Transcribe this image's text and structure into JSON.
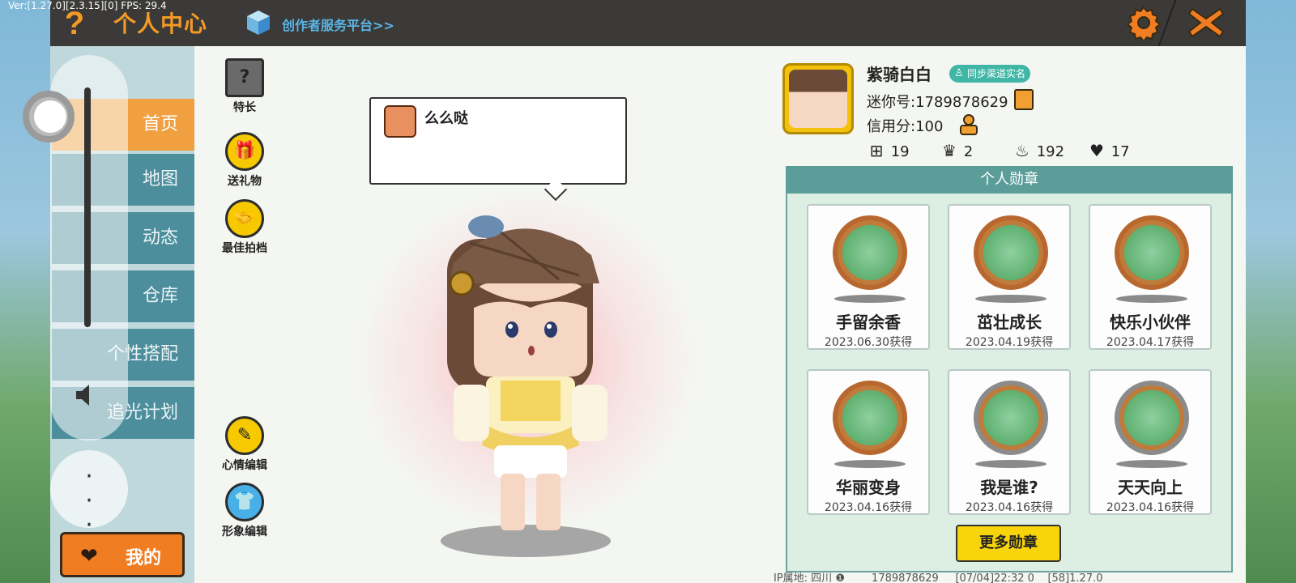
{
  "debug": {
    "version": "Ver:[1.27.0][2.3.15][0] FPS: 29.4"
  },
  "header": {
    "title": "个人中心",
    "help_icon": "question-mark",
    "creator_link": "创作者服务平台>>",
    "settings_icon": "gear",
    "close_icon": "x"
  },
  "menu": {
    "items": [
      {
        "label": "首页",
        "active": true
      },
      {
        "label": "地图"
      },
      {
        "label": "动态"
      },
      {
        "label": "仓库"
      },
      {
        "label": "个性搭配"
      },
      {
        "label": "追光计划"
      }
    ],
    "mine_label": "我的"
  },
  "actions": {
    "talent": "特长",
    "gift": "送礼物",
    "partner": "最佳拍档",
    "mood_edit": "心情编辑",
    "image_edit": "形象编辑"
  },
  "bubble": {
    "text": "么么哒"
  },
  "profile": {
    "nickname": "紫骑白白",
    "realname_badge": "同步渠道实名",
    "mini_id": "迷你号:1789878629",
    "credit": "信用分:100",
    "stats": {
      "following": "19",
      "fans": "2",
      "popularity": "192",
      "likes": "17"
    }
  },
  "badges": {
    "title": "个人勋章",
    "items": [
      {
        "name": "手留余香",
        "date": "2023.06.30获得"
      },
      {
        "name": "茁壮成长",
        "date": "2023.04.19获得"
      },
      {
        "name": "快乐小伙伴",
        "date": "2023.04.17获得"
      },
      {
        "name": "华丽变身",
        "date": "2023.04.16获得"
      },
      {
        "name": "我是谁?",
        "date": "2023.04.16获得"
      },
      {
        "name": "天天向上",
        "date": "2023.04.16获得"
      }
    ],
    "more_label": "更多勋章"
  },
  "footer": {
    "ip_text": "IP属地: 四川 ❶",
    "id_text": "1789878629",
    "session_text": "[07/04]22:32 0",
    "build_text": "[58]1.27.0"
  },
  "colors": {
    "accent_orange": "#f29a25",
    "menu_teal": "#4d8e9c",
    "badge_header": "#5b9d99",
    "yellow_button": "#f8d40a"
  }
}
